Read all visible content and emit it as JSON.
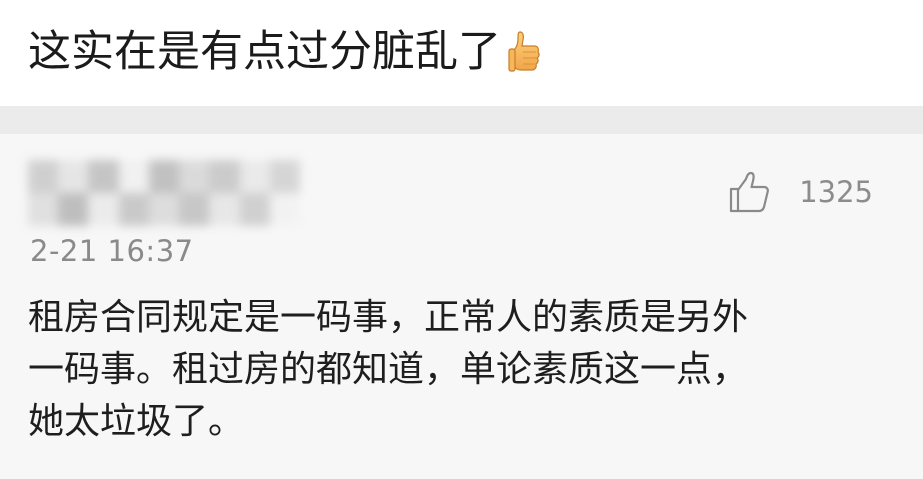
{
  "post": {
    "text": "这实在是有点过分脏乱了",
    "emoji": "thumbs-up-emoji"
  },
  "comment": {
    "timestamp": "2-21 16:37",
    "likes": "1325",
    "like_icon": "thumbs-up-outline-icon",
    "lines": [
      "租房合同规定是一码事，正常人的素质是另外",
      "一码事。租过房的都知道，单论素质这一点，",
      "她太垃圾了。"
    ]
  }
}
